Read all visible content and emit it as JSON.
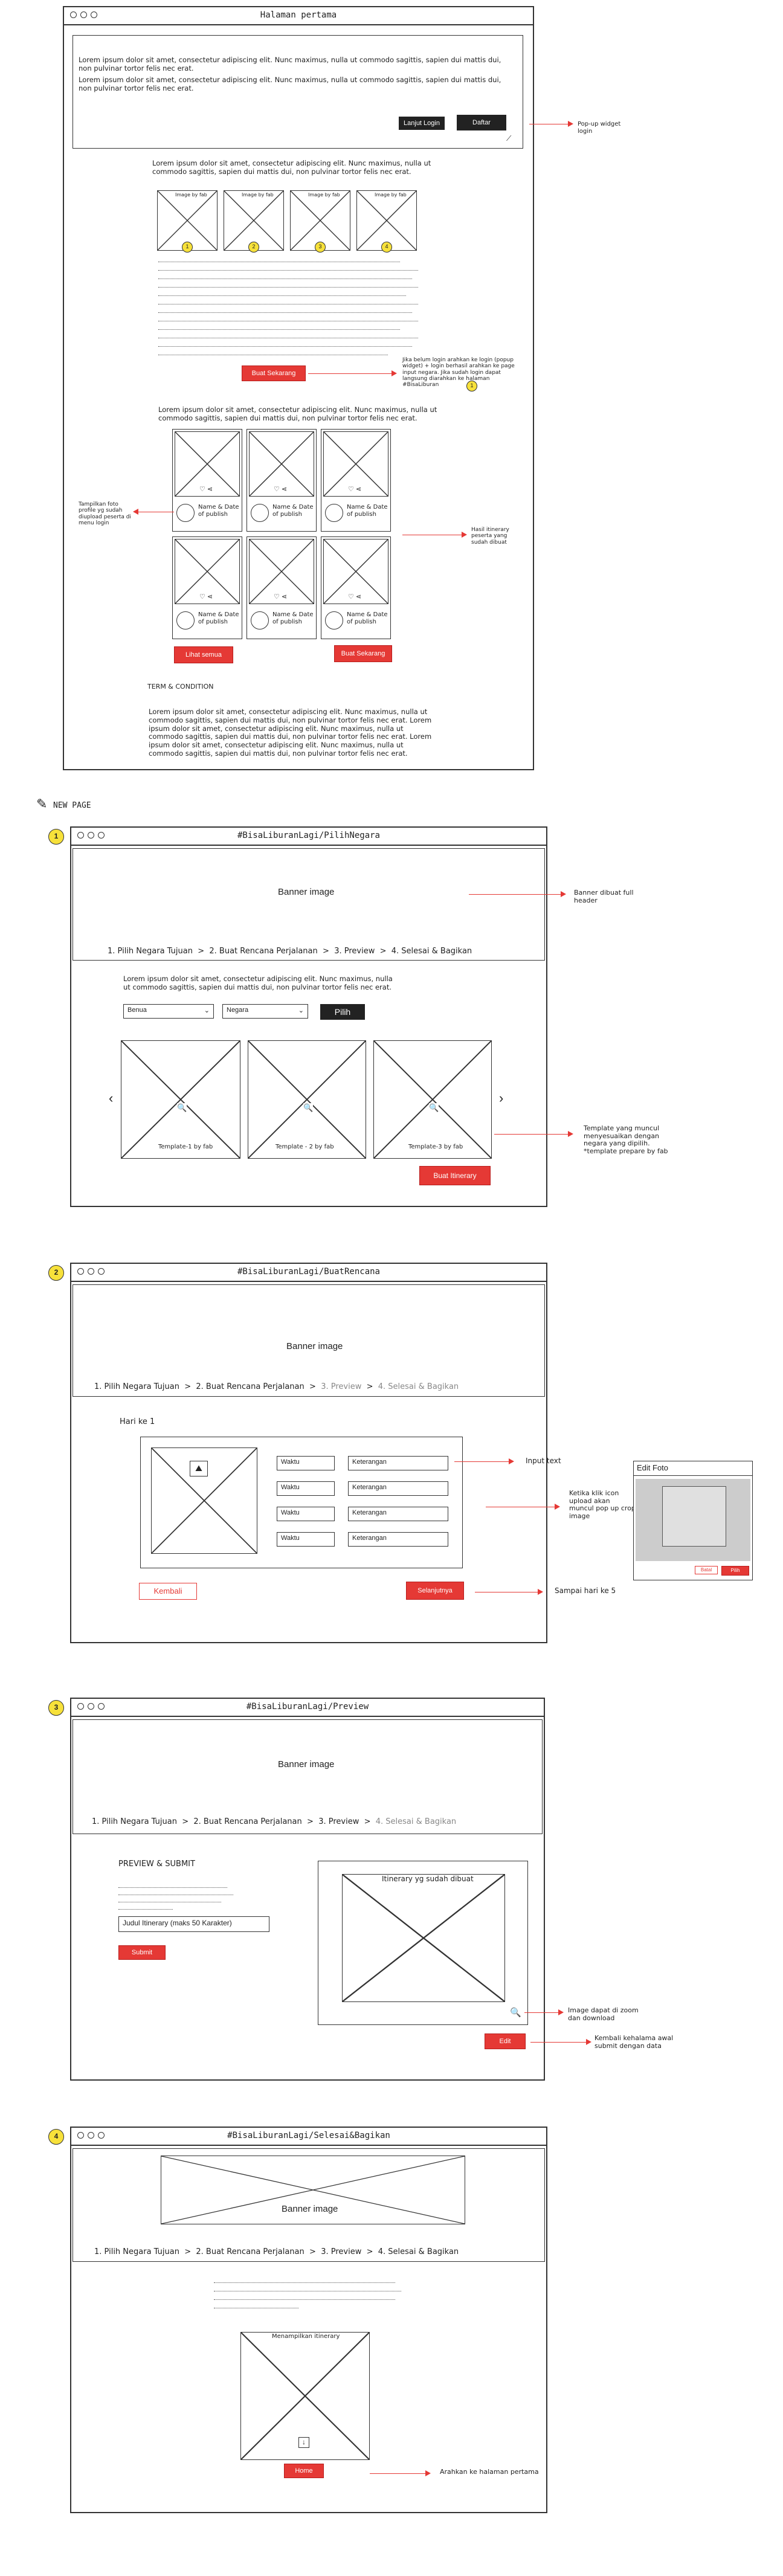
{
  "page1": {
    "title": "Halaman pertama",
    "popup_text_1": "Lorem ipsum dolor sit amet, consectetur adipiscing elit. Nunc maximus, nulla ut commodo sagittis, sapien dui mattis dui, non pulvinar tortor felis nec erat.",
    "popup_text_2": "Lorem ipsum dolor sit amet, consectetur adipiscing elit. Nunc maximus, nulla ut commodo sagittis, sapien dui mattis dui, non pulvinar tortor felis nec erat.",
    "btn_login": "Lanjut Login",
    "btn_daftar": "Daftar",
    "note_popup": "Pop-up widget login",
    "intro_text": "Lorem ipsum dolor sit amet, consectetur adipiscing elit. Nunc maximus, nulla ut commodo sagittis, sapien dui mattis dui, non pulvinar tortor felis nec erat.",
    "image_label": "Image by fab",
    "badges": [
      "1",
      "2",
      "3",
      "4"
    ],
    "btn_buat_sekarang": "Buat Sekarang",
    "note_buat": "Jika belum login arahkan ke login (popup widget) + login berhasil arahkan ke page input negara. Jika sudah login dapat langsung diarahkan ke halaman #BisaLiburan",
    "note_buat_badge": "1",
    "gallery_text": "Lorem ipsum dolor sit amet, consectetur adipiscing elit. Nunc maximus, nulla ut commodo sagittis, sapien dui mattis dui, non pulvinar tortor felis nec erat.",
    "card_caption": "Name & Date of publish",
    "note_profile": "Tampilkan foto profile yg sudah diupload peserta di menu login",
    "note_itinerary": "Hasil itinerary peserta yang sudah dibuat",
    "btn_lihat_semua": "Lihat semua",
    "btn_buat_sekarang_2": "Buat Sekarang",
    "terms_heading": "TERM & CONDITION",
    "terms_text": "Lorem ipsum dolor sit amet, consectetur adipiscing elit. Nunc maximus, nulla ut commodo sagittis, sapien dui mattis dui, non pulvinar tortor felis nec erat. Lorem ipsum dolor sit amet, consectetur adipiscing elit. Nunc maximus, nulla ut commodo sagittis, sapien dui mattis dui, non pulvinar tortor felis nec erat. Lorem ipsum dolor sit amet, consectetur adipiscing elit. Nunc maximus, nulla ut commodo sagittis, sapien dui mattis dui, non pulvinar tortor felis nec erat."
  },
  "new_page_label": "NEW PAGE",
  "steps": {
    "s1": "1. Pilih Negara Tujuan",
    "s2": "2. Buat Rencana Perjalanan",
    "s3": "3. Preview",
    "s4": "4. Selesai & Bagikan",
    "sep": ">"
  },
  "page2": {
    "badge": "1",
    "title": "#BisaLiburanLagi/PilihNegara",
    "banner": "Banner image",
    "note_banner": "Banner dibuat full header",
    "text": "Lorem ipsum dolor sit amet, consectetur adipiscing elit. Nunc maximus, nulla ut commodo sagittis, sapien dui mattis dui, non pulvinar tortor felis nec erat.",
    "select_benua": "Benua",
    "select_negara": "Negara",
    "btn_pilih": "Pilih",
    "templates": [
      "Template-1 by fab",
      "Template - 2 by fab",
      "Template-3 by fab"
    ],
    "note_template": "Template yang muncul menyesuaikan dengan negara yang dipilih. *template prepare by fab",
    "btn_itinerary": "Buat Itinerary",
    "prev": "‹",
    "next": "›"
  },
  "page3": {
    "badge": "2",
    "title": "#BisaLiburanLagi/BuatRencana",
    "banner": "Banner image",
    "hari_label": "Hari ke 1",
    "waktu": [
      "Waktu",
      "Waktu",
      "Waktu",
      "Waktu"
    ],
    "keterangan": [
      "Keterangan",
      "Keterangan",
      "Keterangan",
      "Keterangan"
    ],
    "note_input": "Input text",
    "note_upload": "Ketika klik icon upload akan muncul pop up crop image",
    "btn_kembali": "Kembali",
    "btn_selanjutnya": "Selanjutnya",
    "note_hari": "Sampai hari ke 5",
    "edit_title": "Edit Foto",
    "edit_cancel": "Batal",
    "edit_ok": "Pilih"
  },
  "page4": {
    "badge": "3",
    "title": "#BisaLiburanLagi/Preview",
    "banner": "Banner image",
    "heading": "PREVIEW & SUBMIT",
    "judul_placeholder": "Judul Itinerary (maks 50 Karakter)",
    "btn_submit": "Submit",
    "preview_label": "Itinerary yg sudah dibuat",
    "btn_edit": "Edit",
    "note_zoom": "Image dapat di zoom dan download",
    "note_edit": "Kembali kehalama awal submit dengan data"
  },
  "page5": {
    "badge": "4",
    "title": "#BisaLiburanLagi/Selesai&Bagikan",
    "banner": "Banner image",
    "result_label": "Menampilkan itinerary",
    "btn_home": "Home",
    "note_home": "Arahkan ke halaman pertama"
  }
}
